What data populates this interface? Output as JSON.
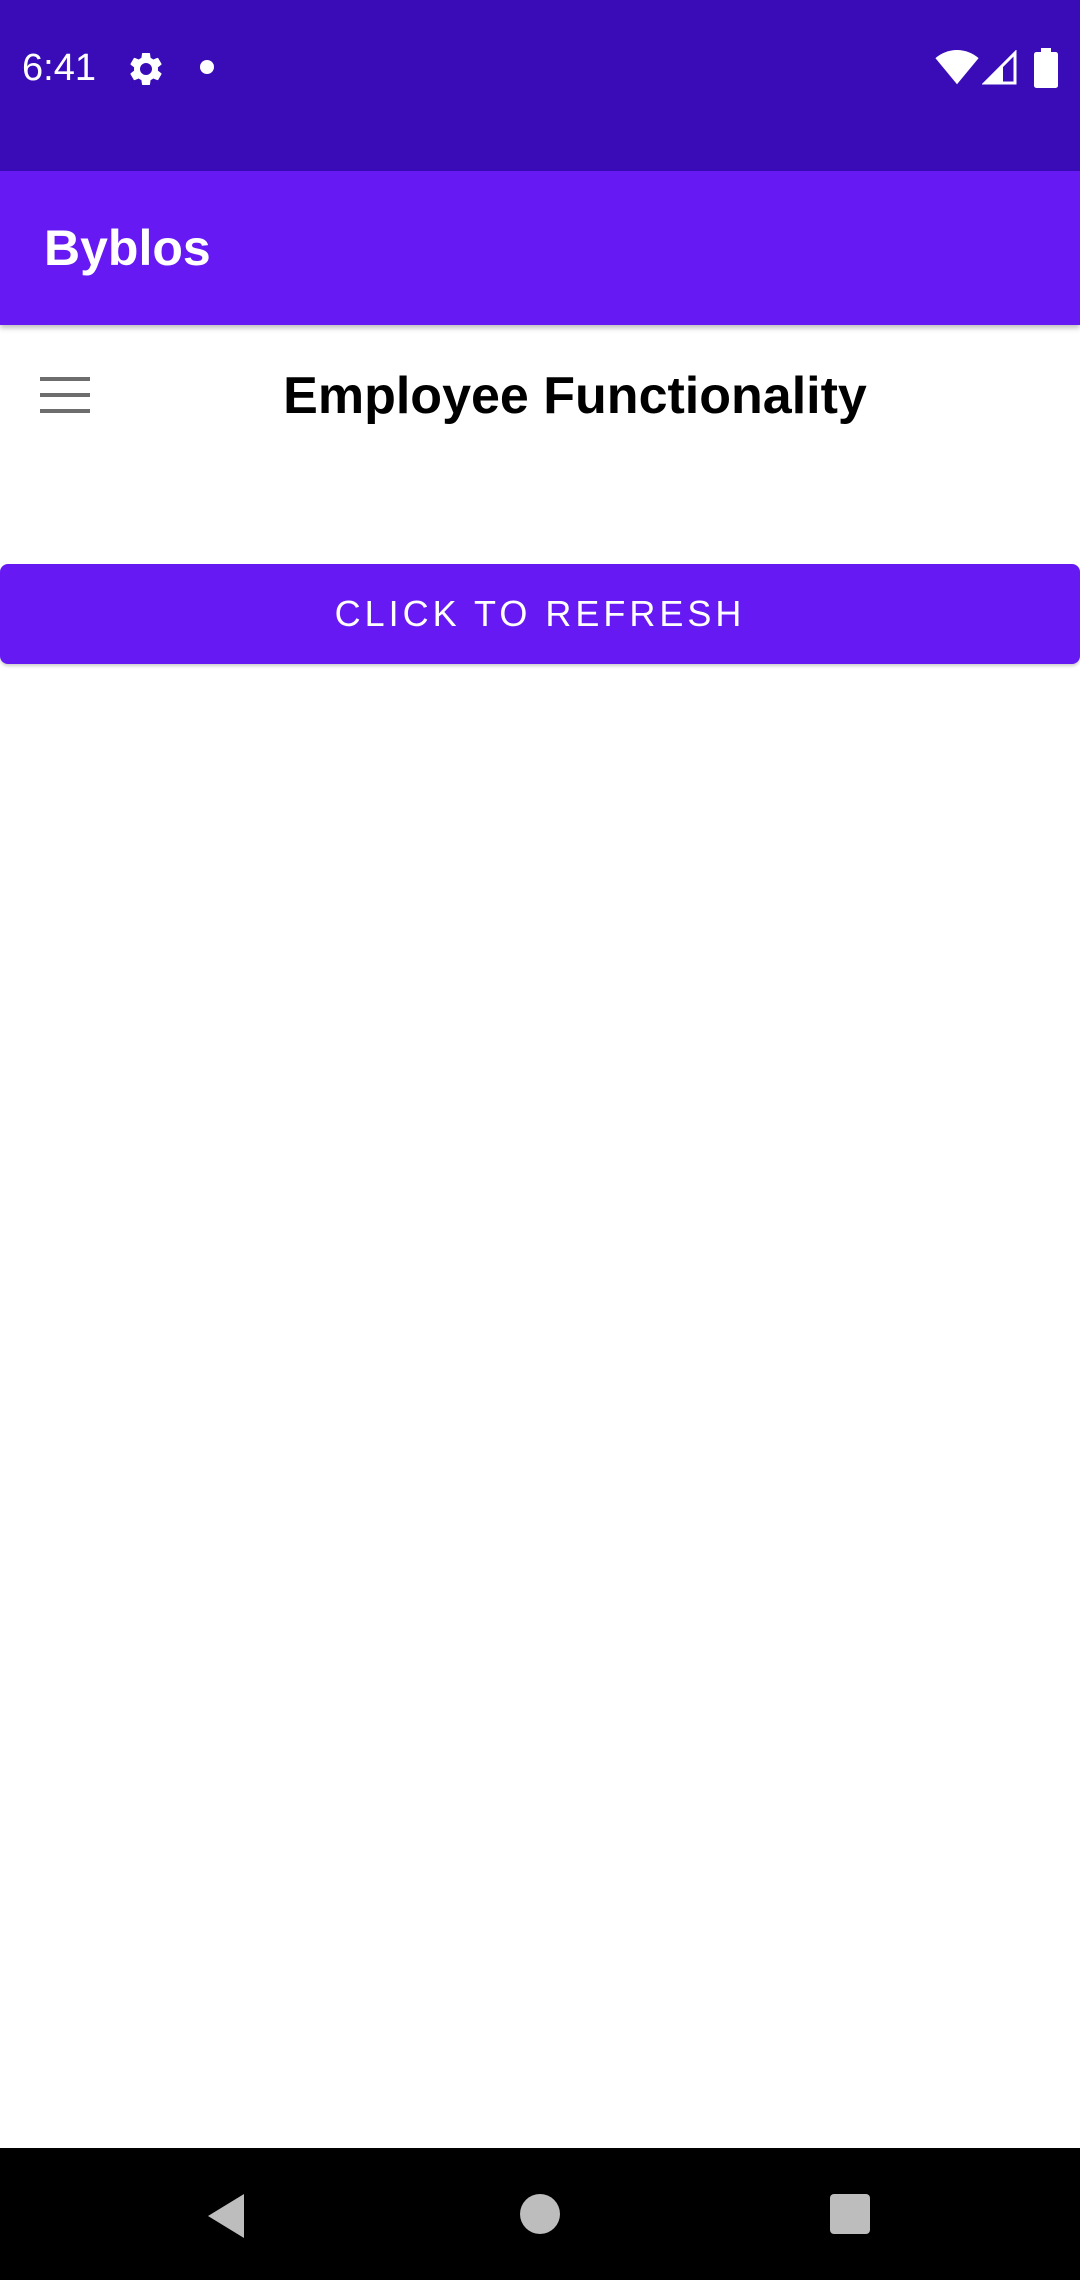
{
  "status_bar": {
    "time": "6:41",
    "icons": [
      "gear-icon",
      "notification-dot-icon",
      "wifi-icon",
      "signal-icon",
      "battery-icon"
    ]
  },
  "app_bar": {
    "title": "Byblos",
    "color": "#6619f3"
  },
  "header": {
    "menu_icon": "hamburger-menu-icon",
    "title": "Employee Functionality"
  },
  "main": {
    "refresh_button_label": "CLICK TO REFRESH"
  },
  "nav_bar": {
    "icons": [
      "back-icon",
      "home-icon",
      "recents-icon"
    ]
  },
  "colors": {
    "status_bar": "#3a0cb8",
    "primary": "#6619f3",
    "nav_bar": "#000000"
  }
}
